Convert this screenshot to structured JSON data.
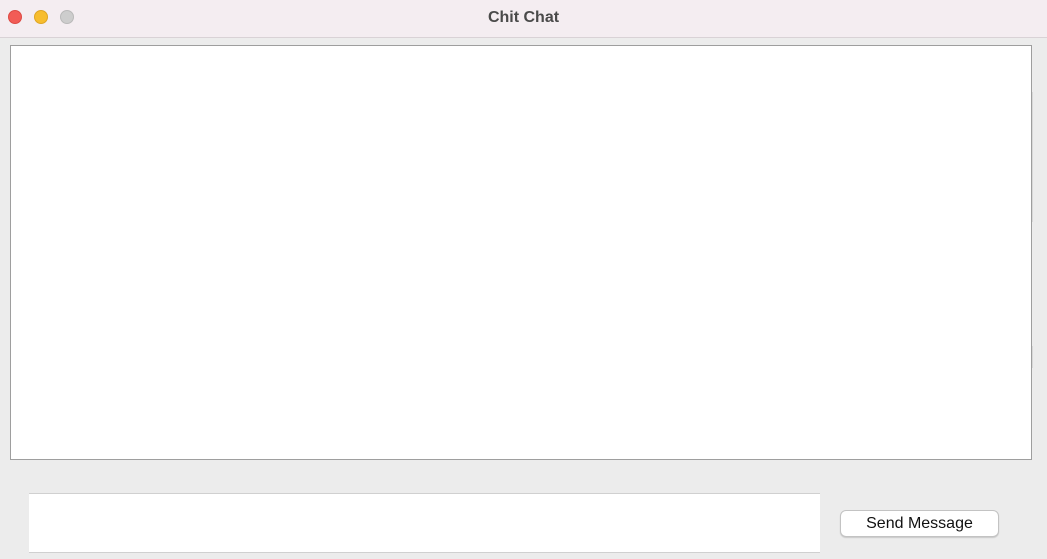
{
  "window": {
    "title": "Chit Chat"
  },
  "chat_log": {
    "content": ""
  },
  "composer": {
    "value": "",
    "send_label": "Send Message"
  },
  "colors": {
    "close": "#f25c56",
    "minimize": "#f7bd2e",
    "zoom": "#cdcdcd",
    "titlebar": "#f4edf1",
    "window_bg": "#ececec"
  }
}
